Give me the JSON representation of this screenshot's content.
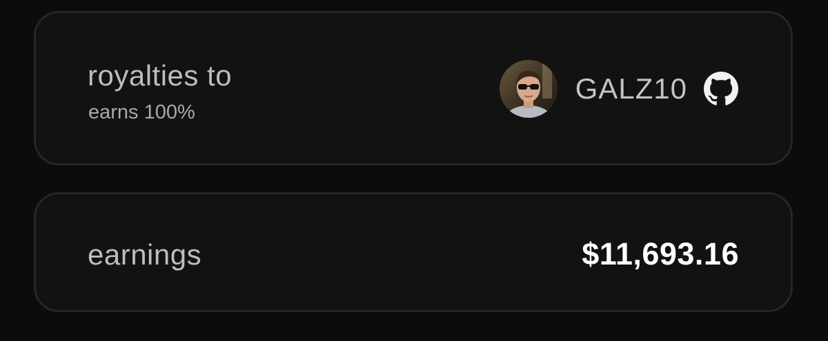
{
  "royalties": {
    "title": "royalties to",
    "share": "earns 100%",
    "recipient": {
      "name": "GALZ10",
      "avatar": "user-avatar-photo",
      "platform_icon": "github-icon"
    }
  },
  "earnings": {
    "label": "earnings",
    "amount": "$11,693.16"
  },
  "colors": {
    "background": "#0c0c0d",
    "card": "#121213",
    "card_border": "#262628",
    "text_muted": "#bdbdbd",
    "text_bright": "#ffffff"
  }
}
